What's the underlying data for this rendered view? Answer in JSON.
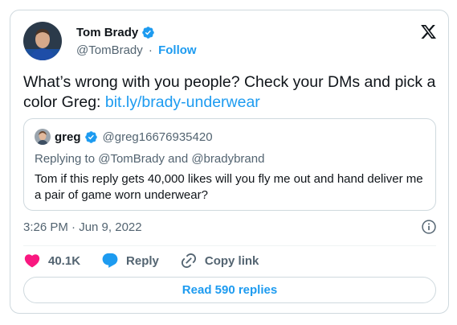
{
  "tweet": {
    "author_name": "Tom Brady",
    "author_handle": "@TomBrady",
    "separator": "·",
    "follow_label": "Follow",
    "text": "What’s wrong with you people? Check your DMs and pick a color Greg: ",
    "link_text": "bit.ly/brady-underwear",
    "timestamp": "3:26 PM · Jun 9, 2022"
  },
  "quoted": {
    "name": "greg",
    "handle": "@greg16676935420",
    "replying_to": "Replying to @TomBrady and @bradybrand",
    "text": "Tom if this reply gets 40,000 likes will you fly me out and hand deliver me a pair of game worn underwear?"
  },
  "actions": {
    "like_count": "40.1K",
    "reply_label": "Reply",
    "copy_link_label": "Copy link"
  },
  "footer": {
    "read_replies_label": "Read 590 replies"
  },
  "icons": {
    "verified": "verified-badge-icon",
    "x_logo": "x-logo-icon",
    "info": "info-icon",
    "heart": "heart-icon",
    "reply": "reply-bubble-icon",
    "link": "link-icon"
  },
  "colors": {
    "accent": "#1d9bf0",
    "like": "#f91880",
    "text": "#0f1419",
    "muted": "#536471",
    "border": "#cfd9de"
  }
}
